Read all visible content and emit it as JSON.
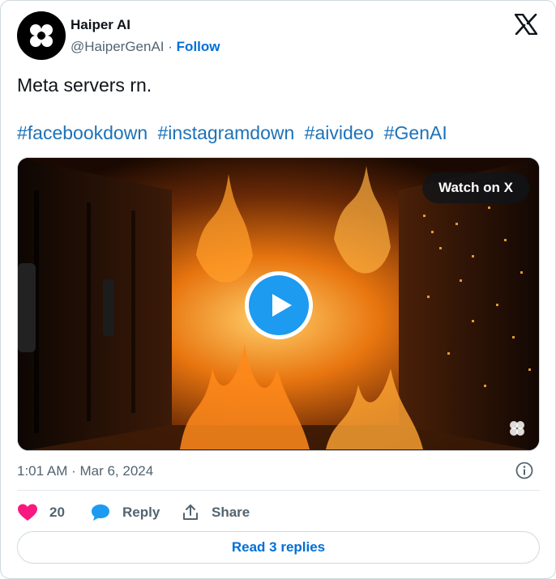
{
  "author": {
    "name": "Haiper AI",
    "handle": "@HaiperGenAI",
    "separator": "·",
    "follow_label": "Follow",
    "avatar_icon": "haiper-logo-icon"
  },
  "platform_icon": "x-logo-icon",
  "tweet": {
    "text": "Meta servers rn.",
    "hashtags": [
      "#facebookdown",
      "#instagramdown",
      "#aivideo",
      "#GenAI"
    ]
  },
  "media": {
    "watch_label": "Watch on X",
    "play_icon": "play-icon",
    "watermark_icon": "haiper-watermark-icon"
  },
  "meta": {
    "timestamp": "1:01 AM · Mar 6, 2024",
    "info_icon": "info-icon"
  },
  "actions": {
    "like_count": "20",
    "like_icon": "heart-icon",
    "like_color": "#f91880",
    "reply_label": "Reply",
    "reply_icon": "speech-bubble-icon",
    "reply_color": "#1d9bf0",
    "share_label": "Share",
    "share_icon": "share-icon"
  },
  "replies": {
    "label": "Read 3 replies"
  },
  "colors": {
    "link": "#006fd6",
    "muted": "#536471",
    "border": "#cfd9de"
  }
}
